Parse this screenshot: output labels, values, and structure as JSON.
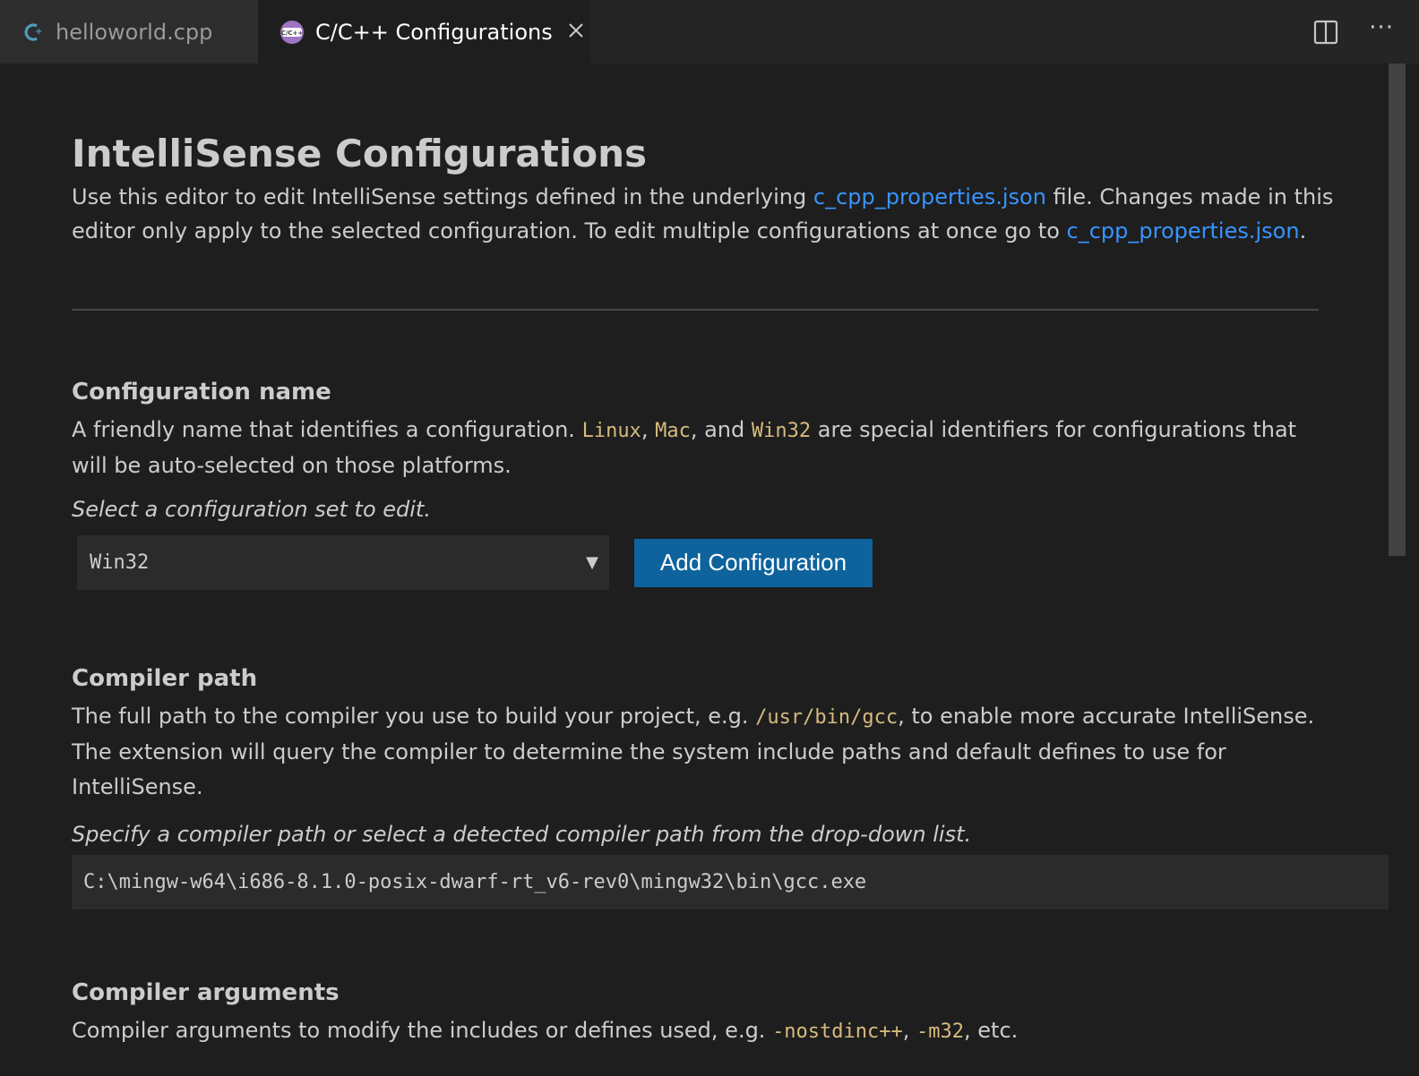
{
  "tabs": [
    {
      "label": "helloworld.cpp",
      "icon": "cpp-file-icon",
      "active": false
    },
    {
      "label": "C/C++ Configurations",
      "icon": "cpp-extension-icon",
      "badge": "C/C++",
      "active": true
    }
  ],
  "tab_actions": {
    "split_icon": "split-editor-icon",
    "more_label": "···"
  },
  "page": {
    "title": "IntelliSense Configurations",
    "intro": {
      "part1": "Use this editor to edit IntelliSense settings defined in the underlying ",
      "link1": "c_cpp_properties.json",
      "part2": " file. Changes made in this editor only apply to the selected configuration. To edit multiple configurations at once go to ",
      "link2": "c_cpp_properties.json",
      "part3": "."
    }
  },
  "config_name": {
    "title": "Configuration name",
    "desc_part1": "A friendly name that identifies a configuration. ",
    "ident1": "Linux",
    "sep1": ", ",
    "ident2": "Mac",
    "sep2": ", and ",
    "ident3": "Win32",
    "desc_part2": " are special identifiers for configurations that will be auto-selected on those platforms.",
    "hint": "Select a configuration set to edit.",
    "selected": "Win32",
    "arrow": "▼",
    "add_button": "Add Configuration"
  },
  "compiler_path": {
    "title": "Compiler path",
    "desc_part1": "The full path to the compiler you use to build your project, e.g. ",
    "example": "/usr/bin/gcc",
    "desc_part2": ", to enable more accurate IntelliSense. The extension will query the compiler to determine the system include paths and default defines to use for IntelliSense.",
    "hint": "Specify a compiler path or select a detected compiler path from the drop-down list.",
    "value": "C:\\mingw-w64\\i686-8.1.0-posix-dwarf-rt_v6-rev0\\mingw32\\bin\\gcc.exe"
  },
  "compiler_args": {
    "title": "Compiler arguments",
    "desc_part1": "Compiler arguments to modify the includes or defines used, e.g. ",
    "arg1": "-nostdinc++",
    "sep": ", ",
    "arg2": "-m32",
    "desc_part2": ", etc."
  },
  "colors": {
    "background": "#1e1e1e",
    "link": "#3794ff",
    "identifier": "#d7ba7d",
    "button": "#0e639c",
    "cpp_badge": "#a074c4"
  }
}
